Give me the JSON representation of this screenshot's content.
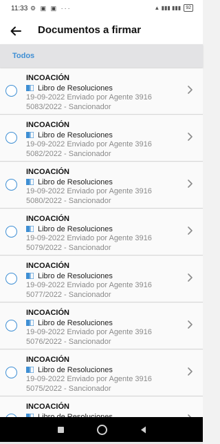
{
  "status_bar": {
    "time": "11:33",
    "left_icons": "⚙ ▣ ▣ ···",
    "right_icons": "▲ ▮▮▮ ▮▮▮",
    "battery": "92"
  },
  "header": {
    "title": "Documentos a firmar",
    "back_icon": "arrow-back-icon"
  },
  "tabs": [
    {
      "label": "Todos",
      "active": true
    }
  ],
  "colors": {
    "accent": "#3f8fd4",
    "secondary_text": "#8a8a8a",
    "header_bg": "#ffffff",
    "tab_bg": "#e3e3e5"
  },
  "documents": [
    {
      "title": "INCOACIÓN",
      "book": "Libro de Resoluciones",
      "line1": "19-09-2022 Enviado por Agente 3916",
      "line2": "5083/2022 - Sancionador"
    },
    {
      "title": "INCOACIÓN",
      "book": "Libro de Resoluciones",
      "line1": "19-09-2022 Enviado por Agente 3916",
      "line2": "5082/2022 - Sancionador"
    },
    {
      "title": "INCOACIÓN",
      "book": "Libro de Resoluciones",
      "line1": "19-09-2022 Enviado por Agente 3916",
      "line2": "5080/2022 - Sancionador"
    },
    {
      "title": "INCOACIÓN",
      "book": "Libro de Resoluciones",
      "line1": "19-09-2022 Enviado por Agente 3916",
      "line2": "5079/2022 - Sancionador"
    },
    {
      "title": "INCOACIÓN",
      "book": "Libro de Resoluciones",
      "line1": "19-09-2022 Enviado por Agente 3916",
      "line2": "5077/2022 - Sancionador"
    },
    {
      "title": "INCOACIÓN",
      "book": "Libro de Resoluciones",
      "line1": "19-09-2022 Enviado por Agente 3916",
      "line2": "5076/2022 - Sancionador"
    },
    {
      "title": "INCOACIÓN",
      "book": "Libro de Resoluciones",
      "line1": "19-09-2022 Enviado por Agente 3916",
      "line2": "5075/2022 - Sancionador"
    },
    {
      "title": "INCOACIÓN",
      "book": "Libro de Resoluciones",
      "line1": "",
      "line2": ""
    }
  ],
  "nav_bar": {
    "buttons": [
      "recents-icon",
      "home-icon",
      "back-triangle-icon"
    ]
  }
}
